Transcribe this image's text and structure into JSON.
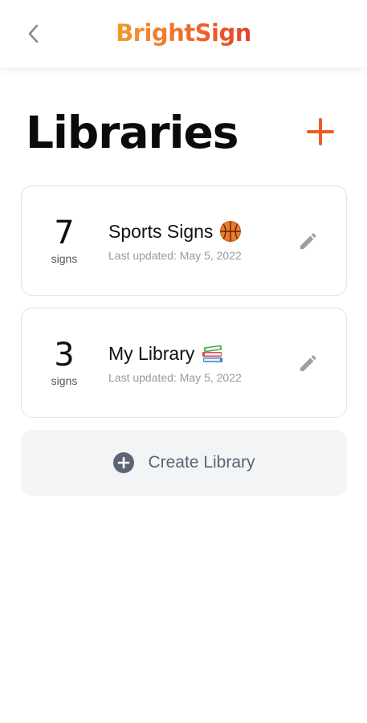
{
  "header": {
    "brand": "BrightSign",
    "back_icon": "chevron-left-icon",
    "brand_gradient": [
      "#f29a2e",
      "#ee6a2c",
      "#e0452a"
    ]
  },
  "page": {
    "title": "Libraries",
    "add_icon": "plus-icon",
    "accent_color": "#ee5a2a"
  },
  "libraries": [
    {
      "count": "7",
      "count_unit": "signs",
      "name": "Sports Signs",
      "emoji": "basketball-icon",
      "updated": "Last updated: May 5, 2022",
      "edit_icon": "pencil-icon"
    },
    {
      "count": "3",
      "count_unit": "signs",
      "name": "My Library",
      "emoji": "books-icon",
      "updated": "Last updated: May 5, 2022",
      "edit_icon": "pencil-icon"
    }
  ],
  "create": {
    "label": "Create Library",
    "icon": "plus-circle-icon"
  }
}
